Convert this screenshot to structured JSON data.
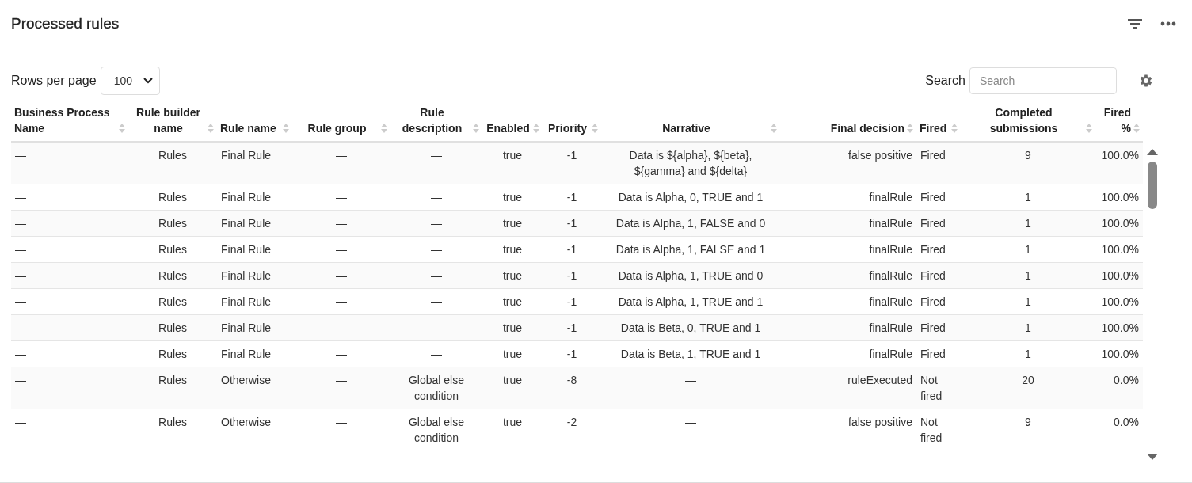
{
  "title": "Processed rules",
  "rows_per_page": {
    "label": "Rows per page",
    "value": "100"
  },
  "search": {
    "label": "Search",
    "placeholder": "Search"
  },
  "table": {
    "columns": [
      "Business Process Name",
      "Rule builder name",
      "Rule name",
      "Rule group",
      "Rule description",
      "Enabled",
      "Priority",
      "Narrative",
      "Final decision",
      "Fired",
      "Completed submissions",
      "Fired %"
    ],
    "rows": [
      [
        "—",
        "Rules",
        "Final Rule",
        "—",
        "—",
        "true",
        "-1",
        "Data is ${alpha}, ${beta}, ${gamma} and ${delta}",
        "false positive",
        "Fired",
        "9",
        "100.0%"
      ],
      [
        "—",
        "Rules",
        "Final Rule",
        "—",
        "—",
        "true",
        "-1",
        "Data is Alpha, 0, TRUE and 1",
        "finalRule",
        "Fired",
        "1",
        "100.0%"
      ],
      [
        "—",
        "Rules",
        "Final Rule",
        "—",
        "—",
        "true",
        "-1",
        "Data is Alpha, 1, FALSE and 0",
        "finalRule",
        "Fired",
        "1",
        "100.0%"
      ],
      [
        "—",
        "Rules",
        "Final Rule",
        "—",
        "—",
        "true",
        "-1",
        "Data is Alpha, 1, FALSE and 1",
        "finalRule",
        "Fired",
        "1",
        "100.0%"
      ],
      [
        "—",
        "Rules",
        "Final Rule",
        "—",
        "—",
        "true",
        "-1",
        "Data is Alpha, 1, TRUE and 0",
        "finalRule",
        "Fired",
        "1",
        "100.0%"
      ],
      [
        "—",
        "Rules",
        "Final Rule",
        "—",
        "—",
        "true",
        "-1",
        "Data is Alpha, 1, TRUE and 1",
        "finalRule",
        "Fired",
        "1",
        "100.0%"
      ],
      [
        "—",
        "Rules",
        "Final Rule",
        "—",
        "—",
        "true",
        "-1",
        "Data is Beta, 0, TRUE and 1",
        "finalRule",
        "Fired",
        "1",
        "100.0%"
      ],
      [
        "—",
        "Rules",
        "Final Rule",
        "—",
        "—",
        "true",
        "-1",
        "Data is Beta, 1, TRUE and 1",
        "finalRule",
        "Fired",
        "1",
        "100.0%"
      ],
      [
        "—",
        "Rules",
        "Otherwise",
        "—",
        "Global else condition",
        "true",
        "-8",
        "—",
        "ruleExecuted",
        "Not fired",
        "20",
        "0.0%"
      ],
      [
        "—",
        "Rules",
        "Otherwise",
        "—",
        "Global else condition",
        "true",
        "-2",
        "—",
        "false positive",
        "Not fired",
        "9",
        "0.0%"
      ]
    ]
  }
}
